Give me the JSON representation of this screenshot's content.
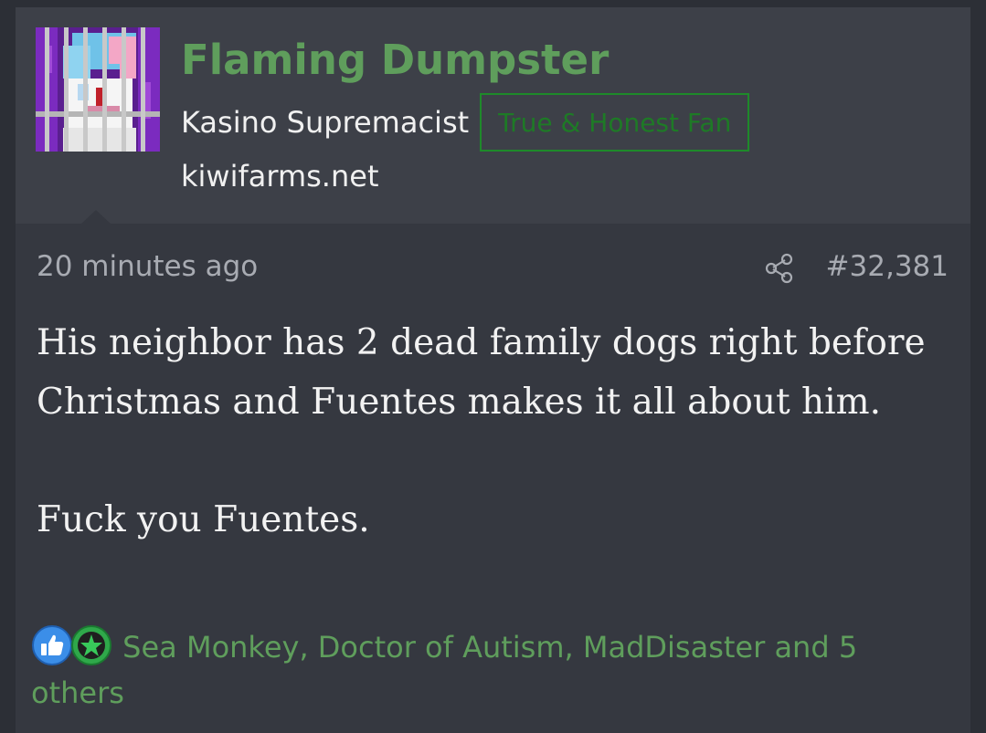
{
  "user": {
    "name": "Flaming Dumpster",
    "title": "Kasino Supremacist",
    "banner": "True & Honest Fan",
    "site": "kiwifarms.net"
  },
  "icons": {
    "avatar": "pixel-art-avatar-behind-bars",
    "share": "share-icon",
    "like": "thumbs-up-icon",
    "winner": "green-star-icon"
  },
  "colors": {
    "username": "#5f9e5c",
    "banner": "#1e8a2a",
    "reactions_link": "#5f9e5c"
  },
  "post": {
    "time": "20 minutes ago",
    "number": "#32,381",
    "paragraph1": "His neighbor has 2 dead family dogs right before Christmas and Fuentes makes it all about him.",
    "paragraph2": "Fuck you Fuentes.",
    "reactions_text": "Sea Monkey, Doctor of Autism, MadDisaster and 5 others"
  }
}
